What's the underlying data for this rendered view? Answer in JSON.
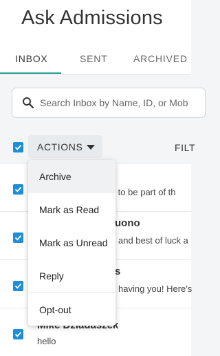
{
  "header": {
    "title": "Ask Admissions"
  },
  "tabs": [
    {
      "label": "INBOX",
      "active": true
    },
    {
      "label": "SENT",
      "active": false
    },
    {
      "label": "ARCHIVED",
      "active": false
    }
  ],
  "search": {
    "placeholder": "Search Inbox by Name, ID, or Mob"
  },
  "toolbar": {
    "actions_label": "ACTIONS",
    "filter_label": "FILT"
  },
  "actions_menu": {
    "items": [
      {
        "label": "Archive"
      },
      {
        "label": "Mark as Read"
      },
      {
        "label": "Mark as Unread"
      },
      {
        "label": "Reply"
      },
      {
        "label": "Opt-out"
      }
    ]
  },
  "messages": [
    {
      "name": "",
      "preview": "ted to be part of th"
    },
    {
      "name": "uono",
      "preview": "and best of luck a"
    },
    {
      "name": "s",
      "preview": "having you! Here's"
    },
    {
      "name": "Mike Dziadaszek",
      "preview": "hello"
    }
  ],
  "colors": {
    "accent": "#2a9d8f",
    "checkbox": "#1e8fd6"
  }
}
